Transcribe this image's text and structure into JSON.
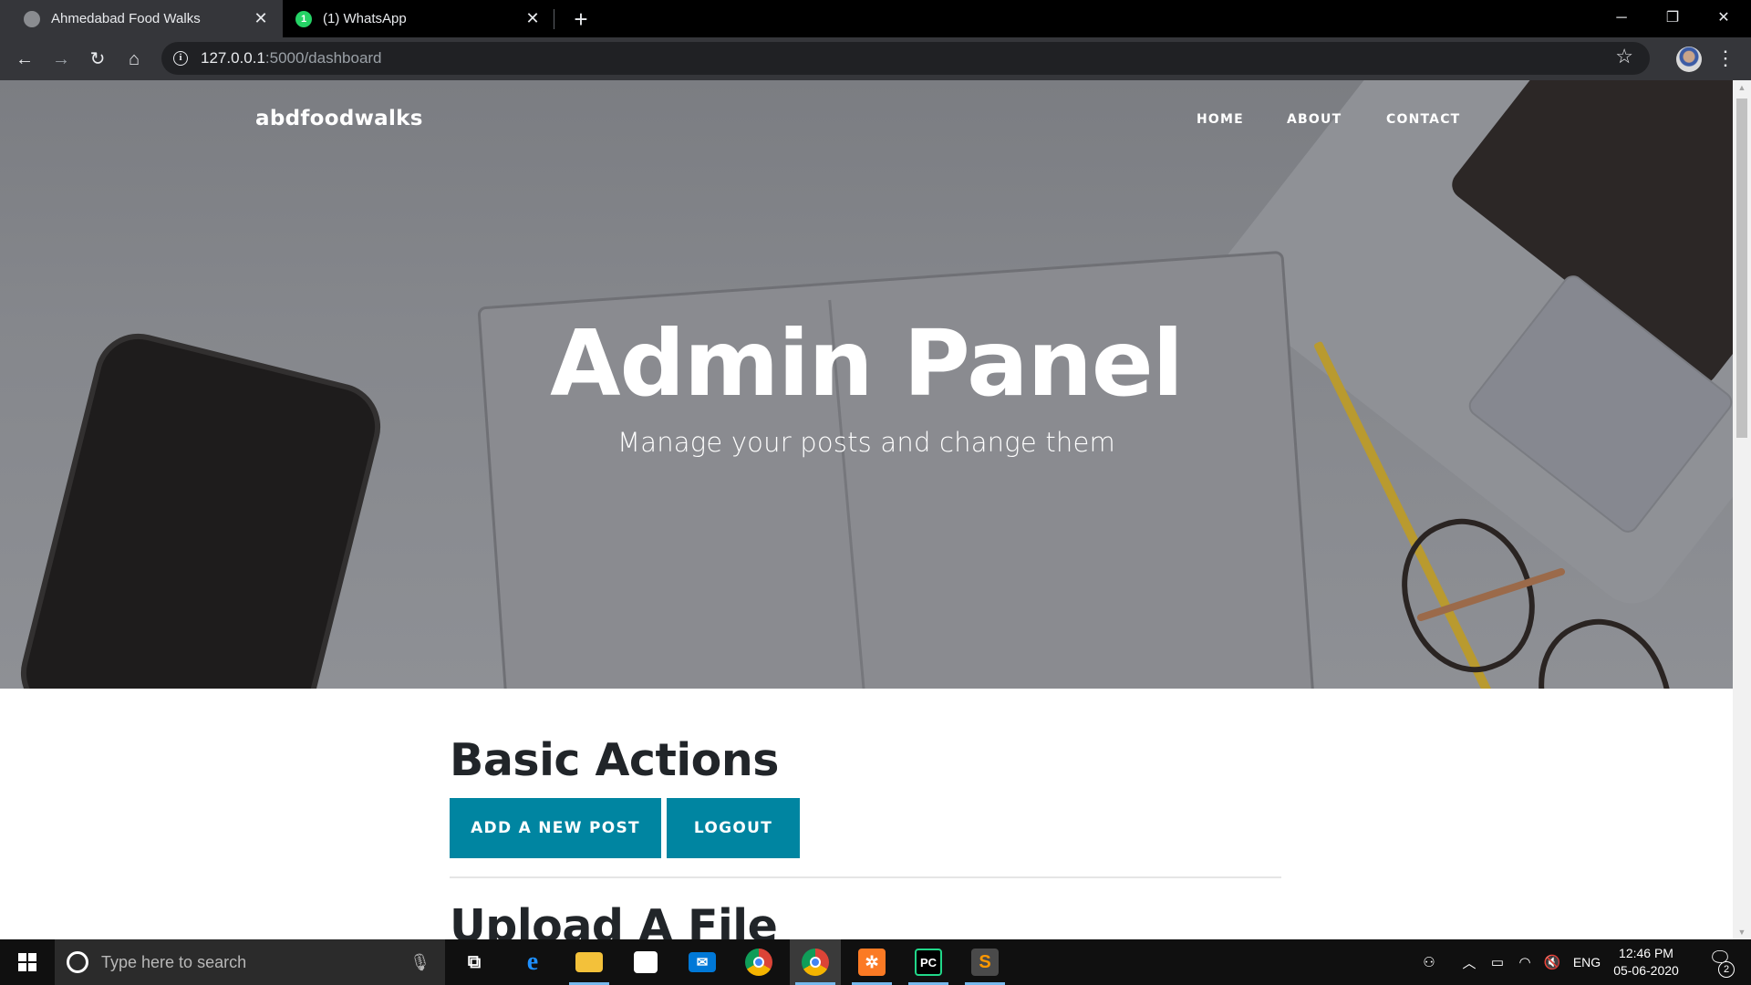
{
  "browser": {
    "tabs": [
      {
        "title": "Ahmedabad Food Walks",
        "active": true
      },
      {
        "title": "(1) WhatsApp",
        "active": false,
        "badge": "1"
      }
    ],
    "url_host": "127.0.0.1",
    "url_path": ":5000/dashboard",
    "window_controls": {
      "minimize": "─",
      "restore": "❐",
      "close": "✕"
    }
  },
  "page": {
    "brand": "abdfoodwalks",
    "nav": [
      {
        "label": "HOME"
      },
      {
        "label": "ABOUT"
      },
      {
        "label": "CONTACT"
      }
    ],
    "hero": {
      "title": "Admin Panel",
      "subtitle": "Manage your posts and change them"
    },
    "basic_actions": {
      "heading": "Basic Actions",
      "add_post_label": "ADD A NEW POST",
      "logout_label": "LOGOUT"
    },
    "upload": {
      "heading": "Upload A File"
    }
  },
  "taskbar": {
    "search_placeholder": "Type here to search",
    "language": "ENG",
    "time": "12:46 PM",
    "date": "05-06-2020",
    "notification_count": "2",
    "pinned_apps": [
      {
        "name": "task-view-icon"
      },
      {
        "name": "edge-icon"
      },
      {
        "name": "file-explorer-icon"
      },
      {
        "name": "store-icon"
      },
      {
        "name": "mail-icon"
      },
      {
        "name": "chrome-icon"
      },
      {
        "name": "chrome-profile-icon"
      },
      {
        "name": "xampp-icon"
      },
      {
        "name": "pycharm-icon"
      },
      {
        "name": "sublime-text-icon"
      }
    ]
  },
  "colors": {
    "accent": "#0085a1",
    "heading_text": "#212529",
    "chrome_dark": "#35363a"
  }
}
